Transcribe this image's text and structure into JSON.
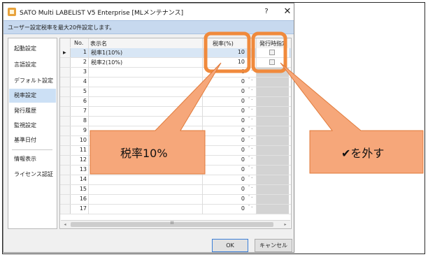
{
  "window": {
    "title": "SATO Multi LABELIST V5 Enterprise [MLメンテナンス]",
    "help": "?",
    "close": "✕"
  },
  "info": "ユーザー設定税率を最大20件設定します。",
  "sidebar": {
    "items": [
      {
        "label": "起動設定"
      },
      {
        "label": "言語設定"
      },
      {
        "label": "デフォルト設定"
      },
      {
        "label": "税率設定",
        "active": true
      },
      {
        "label": "発行履歴"
      },
      {
        "label": "監視設定"
      },
      {
        "label": "基準日付"
      },
      {
        "label": "情報表示"
      },
      {
        "label": "ライセンス認証"
      }
    ]
  },
  "grid": {
    "headers": {
      "no": "No.",
      "name": "表示名",
      "rate": "税率(%)",
      "flag": "発行時指定"
    },
    "rows": [
      {
        "no": "1",
        "name": "税率1(10%)",
        "rate": "10"
      },
      {
        "no": "2",
        "name": "税率2(10%)",
        "rate": "10"
      },
      {
        "no": "3",
        "name": "",
        "rate": "0"
      },
      {
        "no": "4",
        "name": "",
        "rate": "0"
      },
      {
        "no": "5",
        "name": "",
        "rate": "0"
      },
      {
        "no": "6",
        "name": "",
        "rate": "0"
      },
      {
        "no": "7",
        "name": "",
        "rate": "0"
      },
      {
        "no": "8",
        "name": "",
        "rate": "0"
      },
      {
        "no": "9",
        "name": "",
        "rate": "0"
      },
      {
        "no": "10",
        "name": "",
        "rate": "0"
      },
      {
        "no": "11",
        "name": "",
        "rate": "0"
      },
      {
        "no": "12",
        "name": "",
        "rate": "0"
      },
      {
        "no": "13",
        "name": "",
        "rate": "0"
      },
      {
        "no": "14",
        "name": "",
        "rate": "0"
      },
      {
        "no": "15",
        "name": "",
        "rate": "0"
      },
      {
        "no": "16",
        "name": "",
        "rate": "0"
      },
      {
        "no": "17",
        "name": "",
        "rate": "0"
      }
    ],
    "hscroll_grip": "III"
  },
  "buttons": {
    "ok": "OK",
    "cancel": "キャンセル"
  },
  "callouts": {
    "left": "税率10%",
    "right": "✔を外す"
  },
  "colors": {
    "accent": "#f08a3c",
    "callout_fill": "#f6a77a",
    "selection": "#cce0f5",
    "infobar": "#c7d9ef"
  }
}
